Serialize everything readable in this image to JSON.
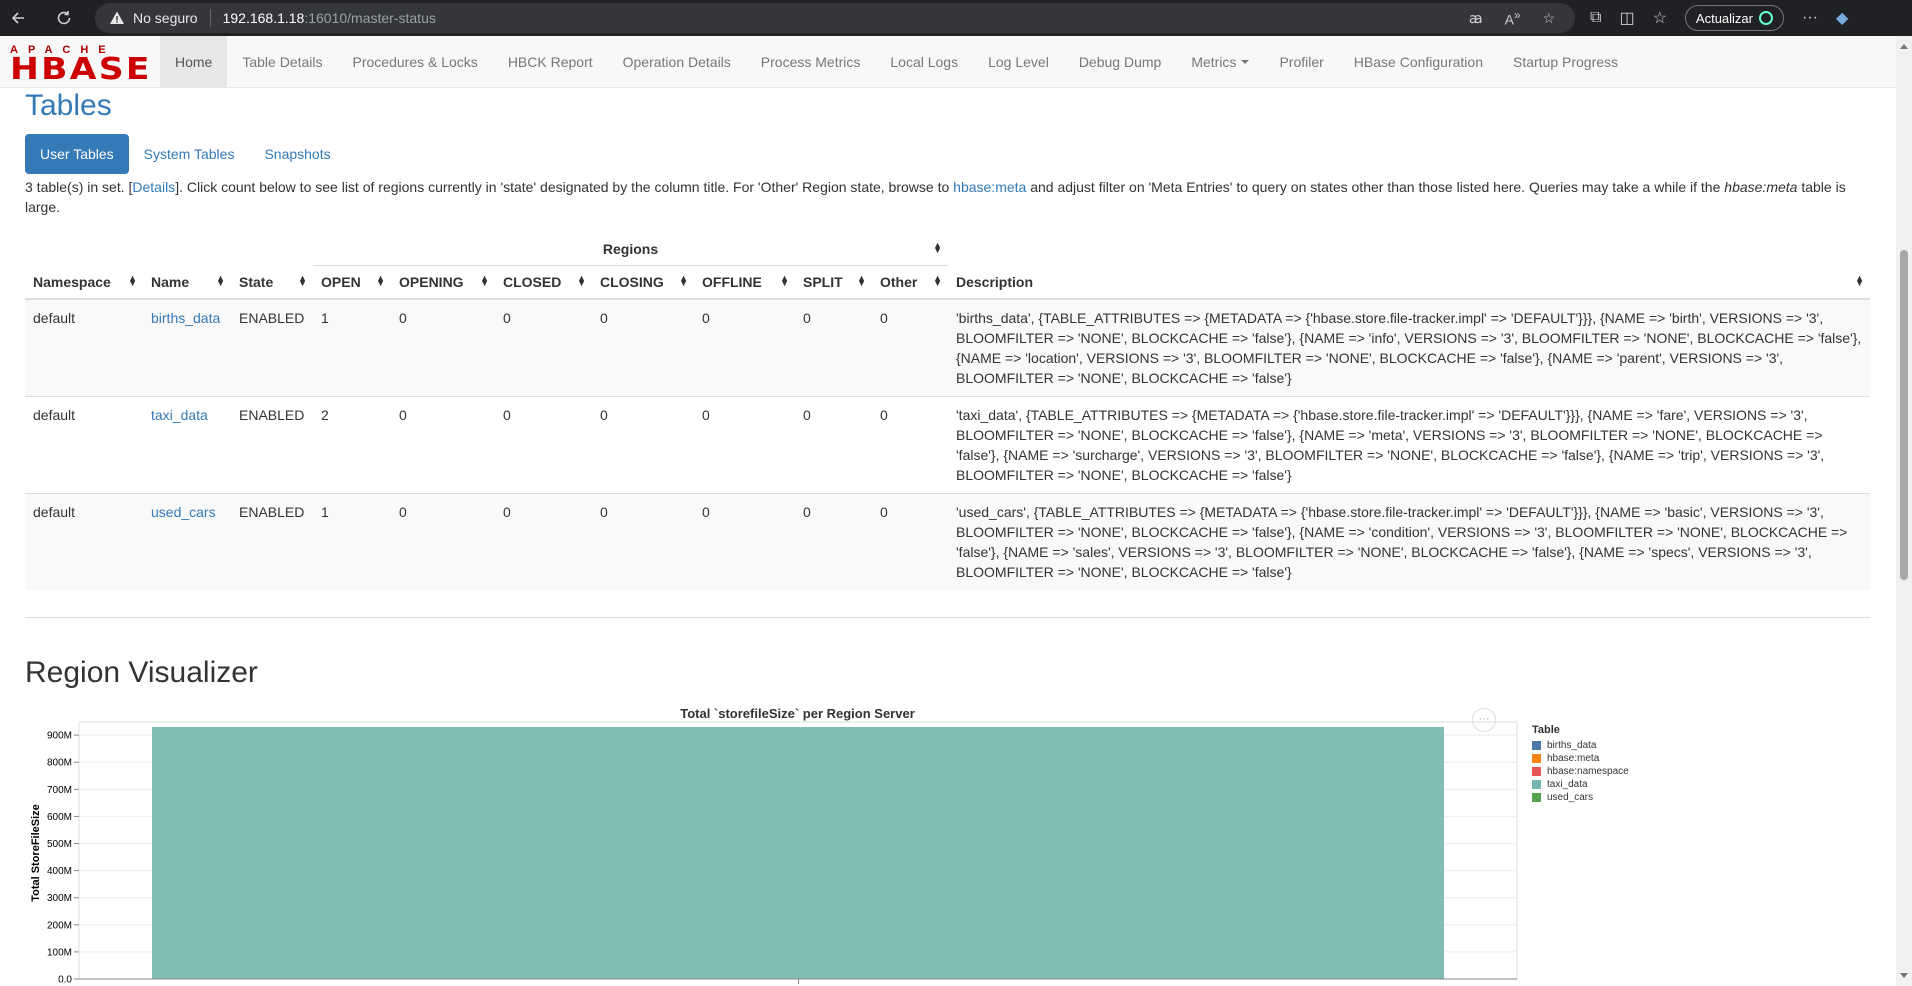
{
  "browser": {
    "security": "No seguro",
    "host": "192.168.1.18",
    "path": ":16010/master-status",
    "update_label": "Actualizar"
  },
  "nav": {
    "items": [
      {
        "label": "Home",
        "active": true
      },
      {
        "label": "Table Details"
      },
      {
        "label": "Procedures & Locks"
      },
      {
        "label": "HBCK Report"
      },
      {
        "label": "Operation Details"
      },
      {
        "label": "Process Metrics"
      },
      {
        "label": "Local Logs"
      },
      {
        "label": "Log Level"
      },
      {
        "label": "Debug Dump"
      },
      {
        "label": "Metrics",
        "dropdown": true
      },
      {
        "label": "Profiler"
      },
      {
        "label": "HBase Configuration"
      },
      {
        "label": "Startup Progress"
      }
    ],
    "logo_top": "APACHE",
    "logo_main": "HBASE"
  },
  "tables": {
    "title": "Tables",
    "tabs": [
      "User Tables",
      "System Tables",
      "Snapshots"
    ],
    "intro_1": "3 table(s) in set. [",
    "intro_details": "Details",
    "intro_2": "]. Click count below to see list of regions currently in 'state' designated by the column title. For 'Other' Region state, browse to ",
    "intro_link": "hbase:meta",
    "intro_3": " and adjust filter on 'Meta Entries' to query on states other than those listed here. Queries may take a while if the ",
    "intro_italic": "hbase:meta",
    "intro_4": " table is large.",
    "headers": {
      "namespace": "Namespace",
      "name": "Name",
      "state": "State",
      "regions": "Regions",
      "open": "OPEN",
      "opening": "OPENING",
      "closed": "CLOSED",
      "closing": "CLOSING",
      "offline": "OFFLINE",
      "split": "SPLIT",
      "other": "Other",
      "description": "Description"
    },
    "rows": [
      {
        "namespace": "default",
        "name": "births_data",
        "state": "ENABLED",
        "open": "1",
        "opening": "0",
        "closed": "0",
        "closing": "0",
        "offline": "0",
        "split": "0",
        "other": "0",
        "description": "'births_data', {TABLE_ATTRIBUTES => {METADATA => {'hbase.store.file-tracker.impl' => 'DEFAULT'}}}, {NAME => 'birth', VERSIONS => '3', BLOOMFILTER => 'NONE', BLOCKCACHE => 'false'}, {NAME => 'info', VERSIONS => '3', BLOOMFILTER => 'NONE', BLOCKCACHE => 'false'}, {NAME => 'location', VERSIONS => '3', BLOOMFILTER => 'NONE', BLOCKCACHE => 'false'}, {NAME => 'parent', VERSIONS => '3', BLOOMFILTER => 'NONE', BLOCKCACHE => 'false'}"
      },
      {
        "namespace": "default",
        "name": "taxi_data",
        "state": "ENABLED",
        "open": "2",
        "opening": "0",
        "closed": "0",
        "closing": "0",
        "offline": "0",
        "split": "0",
        "other": "0",
        "description": "'taxi_data', {TABLE_ATTRIBUTES => {METADATA => {'hbase.store.file-tracker.impl' => 'DEFAULT'}}}, {NAME => 'fare', VERSIONS => '3', BLOOMFILTER => 'NONE', BLOCKCACHE => 'false'}, {NAME => 'meta', VERSIONS => '3', BLOOMFILTER => 'NONE', BLOCKCACHE => 'false'}, {NAME => 'surcharge', VERSIONS => '3', BLOOMFILTER => 'NONE', BLOCKCACHE => 'false'}, {NAME => 'trip', VERSIONS => '3', BLOOMFILTER => 'NONE', BLOCKCACHE => 'false'}"
      },
      {
        "namespace": "default",
        "name": "used_cars",
        "state": "ENABLED",
        "open": "1",
        "opening": "0",
        "closed": "0",
        "closing": "0",
        "offline": "0",
        "split": "0",
        "other": "0",
        "description": "'used_cars', {TABLE_ATTRIBUTES => {METADATA => {'hbase.store.file-tracker.impl' => 'DEFAULT'}}}, {NAME => 'basic', VERSIONS => '3', BLOOMFILTER => 'NONE', BLOCKCACHE => 'false'}, {NAME => 'condition', VERSIONS => '3', BLOOMFILTER => 'NONE', BLOCKCACHE => 'false'}, {NAME => 'sales', VERSIONS => '3', BLOOMFILTER => 'NONE', BLOCKCACHE => 'false'}, {NAME => 'specs', VERSIONS => '3', BLOOMFILTER => 'NONE', BLOCKCACHE => 'false'}"
      }
    ]
  },
  "region_visualizer": {
    "title": "Region Visualizer",
    "more_label": "···"
  },
  "chart_data": {
    "type": "bar",
    "title": "Total `storefileSize` per Region Server",
    "ylabel": "Total StoreFileSize",
    "xlabel": "",
    "ylim": [
      0,
      930
    ],
    "y_ticks": [
      "0.0",
      "100M",
      "200M",
      "300M",
      "400M",
      "500M",
      "600M",
      "700M",
      "800M",
      "900M"
    ],
    "y_tick_values": [
      0,
      100,
      200,
      300,
      400,
      500,
      600,
      700,
      800,
      900
    ],
    "categories": [
      ""
    ],
    "series": [
      {
        "name": "taxi_data",
        "values": [
          930
        ],
        "color": "#80bdb7"
      }
    ],
    "legend_title": "Table",
    "legend": [
      {
        "name": "births_data",
        "color": "#4c78a8"
      },
      {
        "name": "hbase:meta",
        "color": "#f58518"
      },
      {
        "name": "hbase:namespace",
        "color": "#e45756"
      },
      {
        "name": "taxi_data",
        "color": "#72b7b2"
      },
      {
        "name": "used_cars",
        "color": "#54a24b"
      }
    ],
    "legend_position": "right"
  }
}
